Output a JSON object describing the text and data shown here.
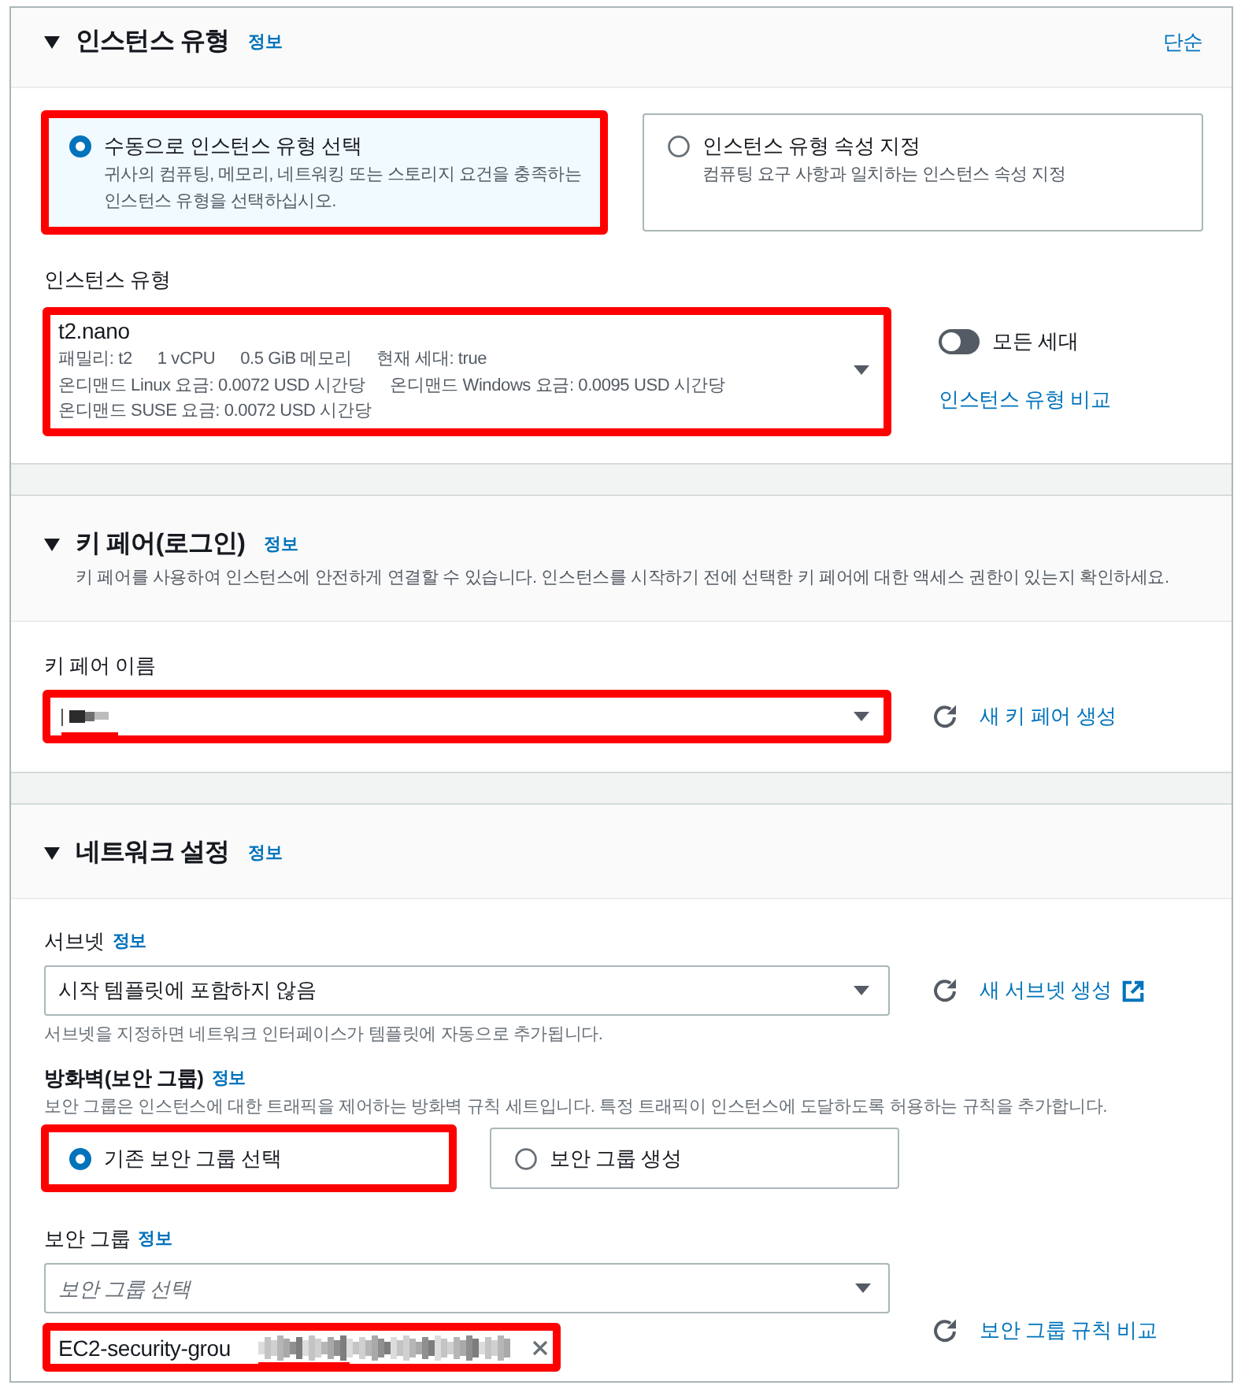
{
  "instance_type": {
    "title": "인스턴스 유형",
    "info": "정보",
    "expanded": true,
    "mode_link": "단순",
    "options": [
      {
        "title": "수동으로 인스턴스 유형 선택",
        "description": "귀사의 컴퓨팅, 메모리, 네트워킹 또는 스토리지 요건을 충족하는 인스턴스 유형을 선택하십시오.",
        "selected": true,
        "highlighted": true
      },
      {
        "title": "인스턴스 유형 속성 지정",
        "description": "컴퓨팅 요구 사항과 일치하는 인스턴스 속성 지정",
        "selected": false,
        "highlighted": false
      }
    ],
    "type_field": {
      "label": "인스턴스 유형",
      "value": "t2.nano",
      "detail_lines": [
        [
          "패밀리: t2",
          "1 vCPU",
          "0.5 GiB 메모리",
          "현재 세대: true"
        ],
        [
          "온디맨드 Linux 요금: 0.0072 USD 시간당",
          "온디맨드 Windows 요금: 0.0095 USD 시간당"
        ],
        [
          "온디맨드 SUSE 요금: 0.0072 USD 시간당"
        ]
      ],
      "highlighted": true
    },
    "all_generations": {
      "label": "모든 세대",
      "on": false
    },
    "compare_link": "인스턴스 유형 비교"
  },
  "key_pair": {
    "title": "키 페어(로그인)",
    "info": "정보",
    "expanded": true,
    "description": "키 페어를 사용하여 인스턴스에 안전하게 연결할 수 있습니다. 인스턴스를 시작하기 전에 선택한 키 페어에 대한 액세스 권한이 있는지 확인하세요.",
    "name_field": {
      "label": "키 페어 이름",
      "redacted": true,
      "underlined": true,
      "highlighted": true
    },
    "create_link": "새 키 페어 생성"
  },
  "network": {
    "title": "네트워크 설정",
    "info": "정보",
    "expanded": true,
    "subnet": {
      "label": "서브넷",
      "info": "정보",
      "value": "시작 템플릿에 포함하지 않음",
      "hint": "서브넷을 지정하면 네트워크 인터페이스가 템플릿에 자동으로 추가됩니다.",
      "create_link": "새 서브넷 생성"
    },
    "firewall": {
      "label": "방화벽(보안 그룹)",
      "info": "정보",
      "description": "보안 그룹은 인스턴스에 대한 트래픽을 제어하는 방화벽 규칙 세트입니다. 특정 트래픽이 인스턴스에 도달하도록 허용하는 규칙을 추가합니다.",
      "options": [
        {
          "title": "기존 보안 그룹 선택",
          "selected": true,
          "highlighted": true
        },
        {
          "title": "보안 그룹 생성",
          "selected": false,
          "highlighted": false
        }
      ]
    },
    "security_groups": {
      "label": "보안 그룹",
      "info": "정보",
      "placeholder": "보안 그룹 선택",
      "compare_link": "보안 그룹 규칙 비교",
      "tokens": [
        {
          "text": "EC2-security-grou",
          "redacted": true,
          "underlined": true,
          "highlighted": true
        }
      ]
    }
  }
}
